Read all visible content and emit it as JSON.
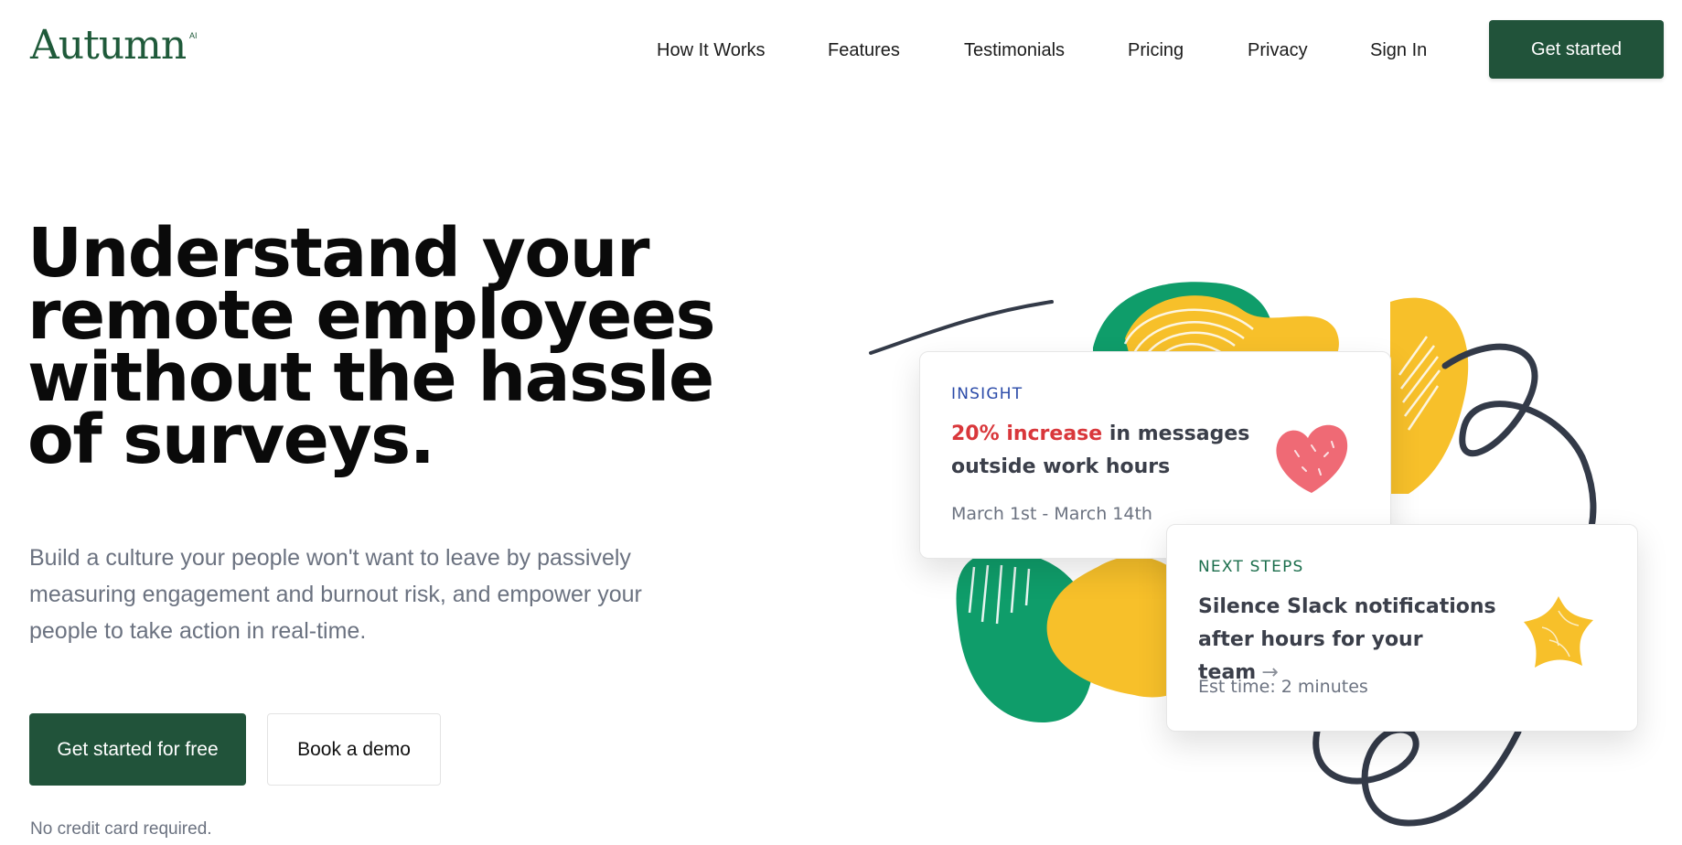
{
  "brand": {
    "name": "Autumn",
    "superscript": "AI",
    "color": "#21533a"
  },
  "nav": {
    "items": [
      "How It Works",
      "Features",
      "Testimonials",
      "Pricing",
      "Privacy",
      "Sign In"
    ],
    "cta": "Get started"
  },
  "hero": {
    "headline": "Understand your remote employees without the hassle of surveys.",
    "subtext": "Build a culture your people won't want to leave by passively measuring engagement and burnout risk, and empower your people to take action in real-time.",
    "primary_button": "Get started for free",
    "secondary_button": "Book a demo",
    "note": "No credit card required."
  },
  "cards": {
    "insight": {
      "tag": "INSIGHT",
      "accent": "20% increase",
      "title_rest": " in messages outside work hours",
      "meta": "March 1st - March 14th",
      "icon": "heart-icon",
      "accent_color": "#d9373b"
    },
    "next_steps": {
      "tag": "NEXT STEPS",
      "title": "Silence Slack notifications after hours for your team",
      "arrow": "→",
      "meta": "Est time: 2 minutes",
      "icon": "star-icon"
    }
  },
  "colors": {
    "green": "#0f9d6a",
    "yellow": "#f7c02a",
    "dark_line": "#333a48",
    "pink": "#ef6a75"
  }
}
